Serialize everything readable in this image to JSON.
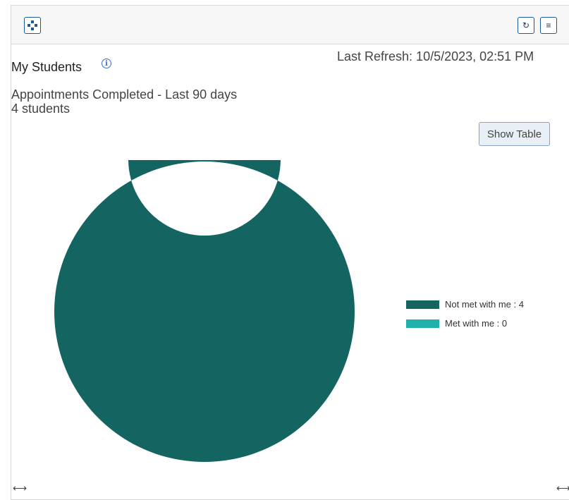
{
  "header": {
    "move_icon": "move-arrows-icon",
    "refresh_icon": "refresh-icon",
    "refresh_glyph": "↻",
    "menu_icon": "hamburger-menu-icon",
    "menu_glyph": "≡"
  },
  "widget": {
    "title": "My Students",
    "info_glyph": "i",
    "last_refresh": "Last Refresh: 10/5/2023, 02:51 PM",
    "subtitle": "Appointments Completed - Last 90 days",
    "count": "4 students",
    "show_table_label": "Show Table",
    "resize_glyph": "⟷"
  },
  "chart_data": {
    "type": "pie",
    "style": "donut",
    "series": [
      {
        "name": "Not met with me",
        "value": 4,
        "color": "#146562"
      },
      {
        "name": "Met with me",
        "value": 0,
        "color": "#20b2aa"
      }
    ],
    "legend": [
      "Not met with me :  4",
      "Met with me :  0"
    ],
    "legend_position": "right"
  }
}
